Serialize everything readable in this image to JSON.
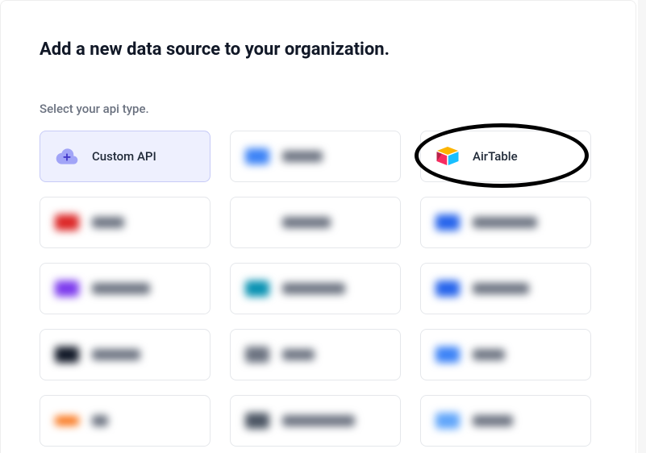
{
  "title": "Add a new data source to your organization.",
  "subtitle": "Select your api type.",
  "cards": {
    "custom_api": {
      "label": "Custom API",
      "selected": true
    },
    "airtable": {
      "label": "AirTable"
    }
  },
  "blur_placeholders": [
    {
      "icon_color": "#3B82F6",
      "label_width": 50
    },
    {
      "icon_color": "#DC2626",
      "label_width": 40
    },
    {
      "icon_color": "#6B7280",
      "label_width": 60
    },
    {
      "icon_color": "#2563EB",
      "label_width": 80
    },
    {
      "icon_color": "#7C3AED",
      "label_width": 72
    },
    {
      "icon_color": "#0891B2",
      "label_width": 78
    },
    {
      "icon_color": "#2563EB",
      "label_width": 70
    },
    {
      "icon_color": "#111827",
      "label_width": 60
    },
    {
      "icon_color": "#6B7280",
      "label_width": 40
    },
    {
      "icon_color": "#3B82F6",
      "label_width": 40
    },
    {
      "icon_color": "#F97316",
      "label_width": 20
    },
    {
      "icon_color": "#4B5563",
      "label_width": 90
    },
    {
      "icon_color": "#60A5FA",
      "label_width": 50
    }
  ]
}
